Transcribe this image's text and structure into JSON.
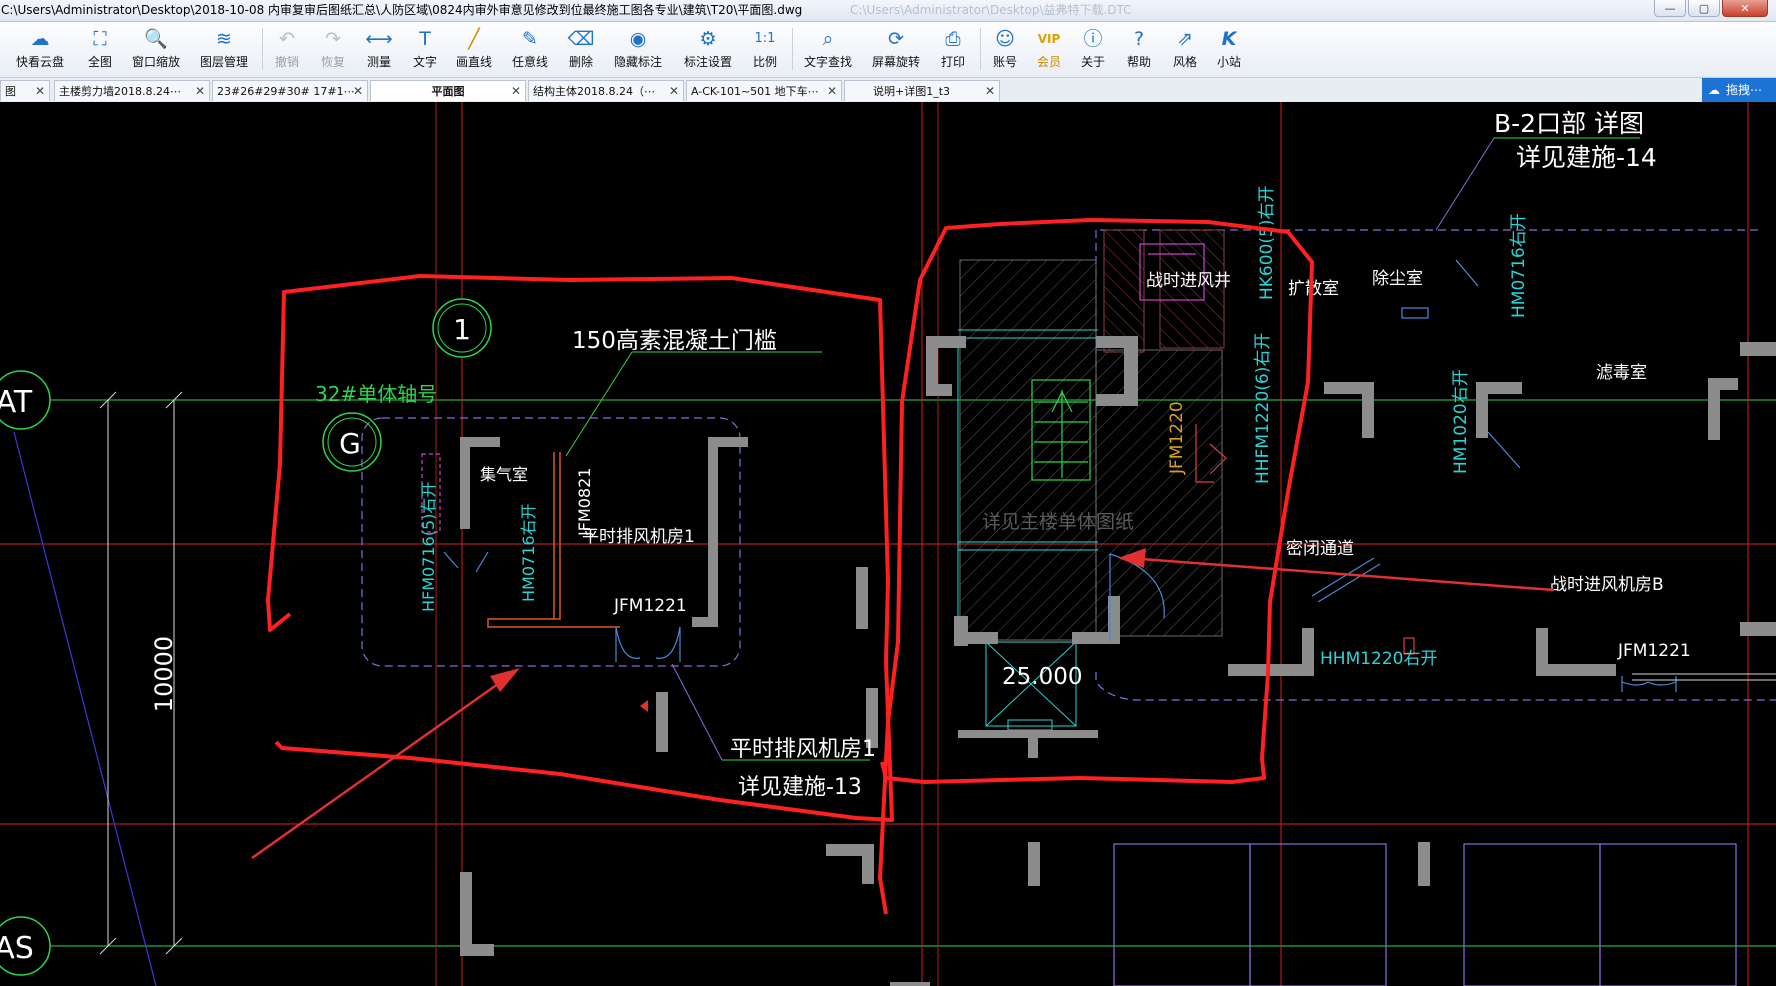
{
  "window": {
    "title": "C:\\Users\\Administrator\\Desktop\\2018-10-08 内审复审后图纸汇总\\人防区域\\0824内审外审意见修改到位最终施工图各专业\\建筑\\T20\\平面图.dwg",
    "ghost_title": "C:\\Users\\Administrator\\Desktop\\益弗特下载.DTC",
    "min": "—",
    "max": "▢",
    "close": "✕"
  },
  "toolbar": {
    "items": [
      {
        "label": "快看云盘",
        "icon": "cloud-icon"
      },
      {
        "label": "全图",
        "icon": "full-view-icon"
      },
      {
        "label": "窗口缩放",
        "icon": "window-zoom-icon"
      },
      {
        "label": "图层管理",
        "icon": "layers-icon"
      },
      {
        "label": "撤销",
        "icon": "undo-icon"
      },
      {
        "label": "恢复",
        "icon": "redo-icon"
      },
      {
        "label": "测量",
        "icon": "measure-icon"
      },
      {
        "label": "文字",
        "icon": "text-icon"
      },
      {
        "label": "画直线",
        "icon": "line-icon"
      },
      {
        "label": "任意线",
        "icon": "freehand-icon"
      },
      {
        "label": "删除",
        "icon": "eraser-icon"
      },
      {
        "label": "隐藏标注",
        "icon": "eye-icon"
      },
      {
        "label": "标注设置",
        "icon": "annotation-settings-icon"
      },
      {
        "label": "比例",
        "icon": "scale-icon"
      },
      {
        "label": "文字查找",
        "icon": "text-search-icon"
      },
      {
        "label": "屏幕旋转",
        "icon": "rotate-screen-icon"
      },
      {
        "label": "打印",
        "icon": "printer-icon"
      },
      {
        "label": "账号",
        "icon": "user-icon"
      },
      {
        "label": "会员",
        "icon": "vip-icon"
      },
      {
        "label": "关于",
        "icon": "info-icon"
      },
      {
        "label": "帮助",
        "icon": "help-icon"
      },
      {
        "label": "风格",
        "icon": "style-icon"
      },
      {
        "label": "小站",
        "icon": "k-station-icon"
      }
    ]
  },
  "tabs": {
    "items": [
      {
        "label": "图"
      },
      {
        "label": "主楼剪力墙2018.8.24⋯"
      },
      {
        "label": "23#26#29#30#    17#1⋯"
      },
      {
        "label": "平面图"
      },
      {
        "label": "结构主体2018.8.24（⋯"
      },
      {
        "label": "A-CK-101~501 地下车⋯"
      },
      {
        "label": "说明+详图1_t3"
      }
    ],
    "close": "✕",
    "right_label": "拖拽⋯"
  },
  "drawing": {
    "b2_title": "B-2口部 详图",
    "b2_ref": "详见建施-14",
    "grid_at": "AT",
    "grid_as": "AS",
    "grid_1": "1",
    "grid_g": "G",
    "axis_note": "32#单体轴号",
    "threshold_note": "150高素混凝土门槛",
    "room_jiqi": "集气室",
    "room_pingshi": "平时排风机房1",
    "door_jfm0821": "JFM0821",
    "door_hm0716": "HM0716右开",
    "door_hfm0716": "HFM0716(5)右开",
    "door_jfm1221_a": "JFM1221",
    "ref_room": "平时排风机房1",
    "ref_sheet": "详见建施-13",
    "dim_10000": "10000",
    "room_zhanshi": "战时进风井",
    "room_kuosan": "扩散室",
    "room_chuchen": "除尘室",
    "room_lvdu": "滤毒室",
    "door_hk600": "HK600(5)右开",
    "door_hm0716b": "HM0716右开",
    "door_hhfm1220": "HHFM1220(6)右开",
    "door_hm1020": "HM1020右开",
    "door_jfm1220": "JFM1220",
    "stair_note": "详见主楼单体图纸",
    "passage": "密闭通道",
    "room_b": "战时进风机房B",
    "elev": "25.000",
    "door_hhm1220": "HHM1220右开",
    "door_jfm1221_b": "JFM1221"
  }
}
